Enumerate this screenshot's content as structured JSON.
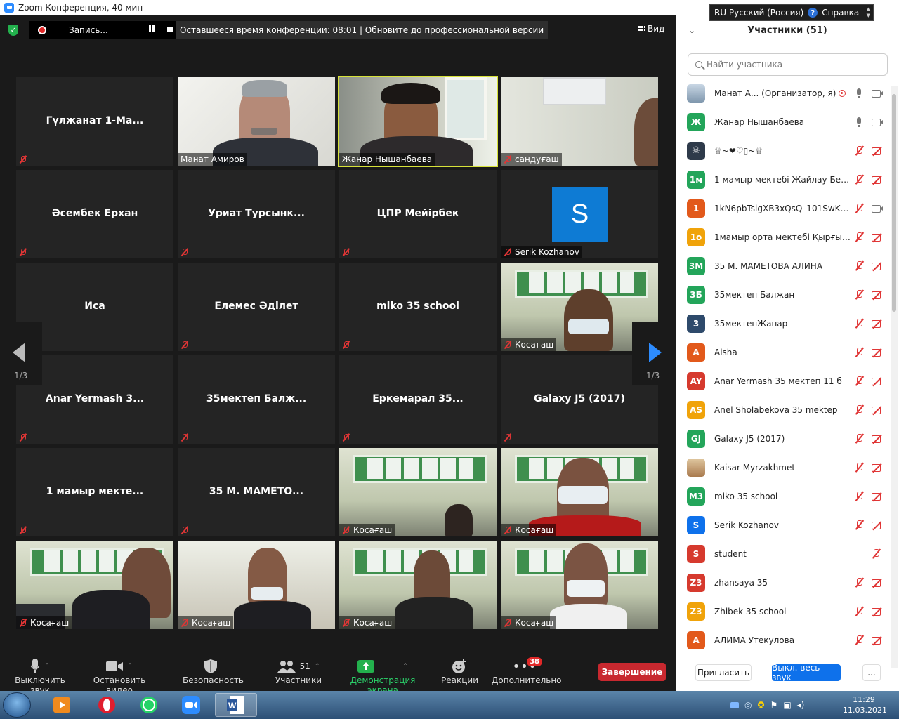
{
  "window": {
    "title": "Zoom Конференция, 40 мин"
  },
  "langbar": {
    "lang": "RU Русский (Россия)",
    "help": "Справка"
  },
  "topbar": {
    "rec_label": "Запись...",
    "timer_text": "Оставшееся время конференции: 08:01 | Обновите до профессиональной версии",
    "view_label": "Вид"
  },
  "tiles": [
    {
      "name": "Гүлжанат  1-Ма...",
      "label": ""
    },
    {
      "name": "",
      "label": "Манат Амиров"
    },
    {
      "name": "",
      "label": "Жанар Нышанбаева"
    },
    {
      "name": "",
      "label": "сандуғаш"
    },
    {
      "name": "Әсембек Ерхан",
      "label": ""
    },
    {
      "name": "Уриат  Турсынк...",
      "label": ""
    },
    {
      "name": "ЦПР Мейірбек",
      "label": ""
    },
    {
      "name": "",
      "label": "Serik Kozhanov"
    },
    {
      "name": "Иса",
      "label": ""
    },
    {
      "name": "Елемес Әділет",
      "label": ""
    },
    {
      "name": "miko 35 school",
      "label": ""
    },
    {
      "name": "",
      "label": "Косағаш"
    },
    {
      "name": "Anar Yermash 3...",
      "label": ""
    },
    {
      "name": "35мектеп  Балж...",
      "label": ""
    },
    {
      "name": "Еркемарал  35...",
      "label": ""
    },
    {
      "name": "Galaxy J5 (2017)",
      "label": ""
    },
    {
      "name": "1 мамыр мекте...",
      "label": ""
    },
    {
      "name": "35 М. МАМЕТО...",
      "label": ""
    },
    {
      "name": "",
      "label": "Косағаш"
    },
    {
      "name": "",
      "label": "Косағаш"
    },
    {
      "name": "",
      "label": "Косағаш"
    },
    {
      "name": "",
      "label": "Косағаш"
    },
    {
      "name": "",
      "label": "Косағаш"
    },
    {
      "name": "",
      "label": "Косағаш"
    }
  ],
  "serik_avatar": "S",
  "pager": {
    "left": "1/3",
    "right": "1/3"
  },
  "toolbar": {
    "mute": "Выключить звук",
    "video": "Остановить видео",
    "security": "Безопасность",
    "participants": "Участники",
    "participants_count": "51",
    "share": "Демонстрация экрана",
    "reactions": "Реакции",
    "more": "Дополнительно",
    "more_badge": "38",
    "end": "Завершение"
  },
  "panel": {
    "title": "Участники (51)",
    "search_placeholder": "Найти участника",
    "invite": "Пригласить",
    "mute_all": "Выкл. весь звук",
    "more": "...",
    "participants": [
      {
        "initials": "",
        "color": "#8fa6b8",
        "name": "Манат А...  (Организатор, я)"
      },
      {
        "initials": "Ж",
        "color": "#23a55a",
        "name": "Жанар Нышанбаева"
      },
      {
        "initials": "",
        "color": "#2e3a4a",
        "name": "♕~❤♡▯~♕"
      },
      {
        "initials": "1м",
        "color": "#23a55a",
        "name": "1 мамыр мектебі Жайлау Берік"
      },
      {
        "initials": "1",
        "color": "#e2591b",
        "name": "1kN6pbTsigXB3xQsQ_101SwKg..."
      },
      {
        "initials": "1o",
        "color": "#f0a30a",
        "name": "1мамыр орта мектебі Қырғыз..."
      },
      {
        "initials": "3М",
        "color": "#23a55a",
        "name": "35 М. МАМЕТОВА АЛИНА"
      },
      {
        "initials": "3Б",
        "color": "#23a55a",
        "name": "35мектеп Балжан"
      },
      {
        "initials": "3",
        "color": "#2e4a6b",
        "name": "35мектепЖанар"
      },
      {
        "initials": "A",
        "color": "#e2591b",
        "name": "Aisha"
      },
      {
        "initials": "AY",
        "color": "#d63a2e",
        "name": "Anar Yermash 35 мектеп 11 б"
      },
      {
        "initials": "AS",
        "color": "#f0a30a",
        "name": "Anel Sholabekova 35 mektep"
      },
      {
        "initials": "GJ",
        "color": "#23a55a",
        "name": "Galaxy J5 (2017)"
      },
      {
        "initials": "",
        "color": "#c8a070",
        "name": "Kaisar Myrzakhmet"
      },
      {
        "initials": "M3",
        "color": "#23a55a",
        "name": "miko 35 school"
      },
      {
        "initials": "S",
        "color": "#0e71eb",
        "name": "Serik Kozhanov"
      },
      {
        "initials": "S",
        "color": "#d63a2e",
        "name": "student"
      },
      {
        "initials": "Z3",
        "color": "#d63a2e",
        "name": "zhansaya 35"
      },
      {
        "initials": "Z3",
        "color": "#f0a30a",
        "name": "Zhibek 35 school"
      },
      {
        "initials": "А",
        "color": "#e2591b",
        "name": "АЛИМА Утекулова"
      }
    ]
  },
  "clock": {
    "time": "11:29",
    "date": "11.03.2021"
  }
}
